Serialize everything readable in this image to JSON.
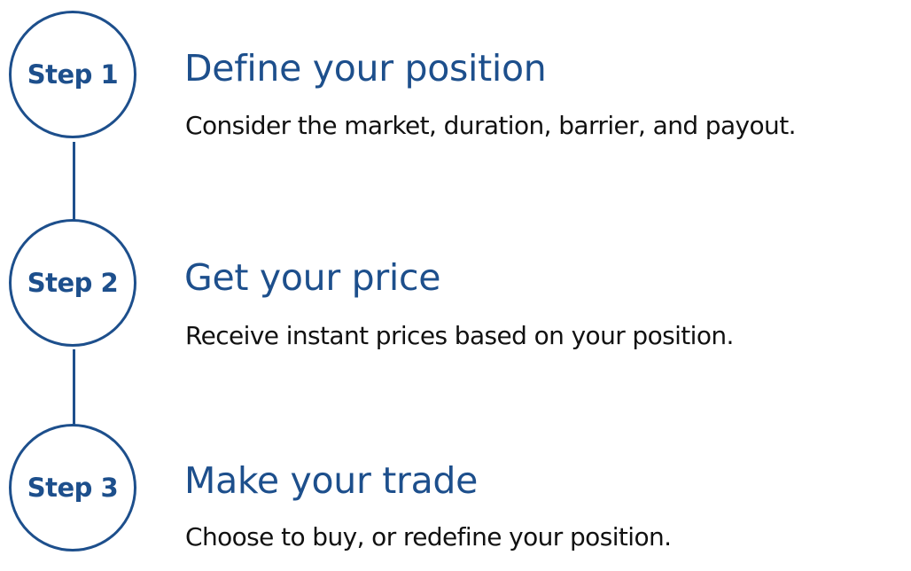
{
  "colors": {
    "accent": "#1d4f8c",
    "text": "#111111",
    "background": "#ffffff"
  },
  "steps": [
    {
      "label": "Step 1",
      "title": "Define your position",
      "description": "Consider the market, duration, barrier, and payout."
    },
    {
      "label": "Step 2",
      "title": "Get your price",
      "description": "Receive instant prices based on your position."
    },
    {
      "label": "Step 3",
      "title": "Make your trade",
      "description": "Choose to buy, or redefine your position."
    }
  ]
}
